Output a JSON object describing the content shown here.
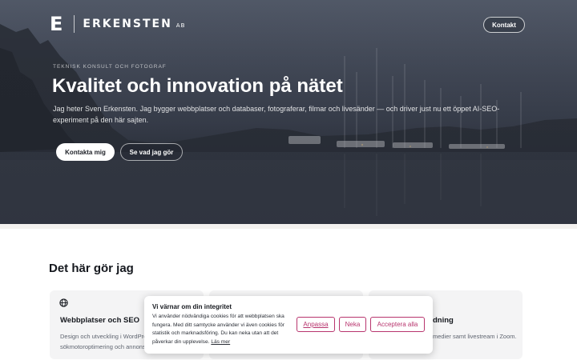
{
  "header": {
    "logo_mark": "E",
    "logo_name": "ERKENSTEN",
    "logo_suffix": "AB",
    "contact_label": "Kontakt"
  },
  "hero": {
    "eyebrow": "TEKNISK KONSULT OCH FOTOGRAF",
    "headline": "Kvalitet och innovation på nätet",
    "intro": "Jag heter Sven Erkensten. Jag bygger webbplatser och databaser, fotograferar, filmar och livesänder — och driver just nu ett öppet AI-SEO-experiment på den här sajten.",
    "primary_button": "Kontakta mig",
    "secondary_button": "Se vad jag gör"
  },
  "services": {
    "title": "Det här gör jag",
    "cards": [
      {
        "icon": "globe-icon",
        "title": "Webbplatser och SEO",
        "text": "Design och utveckling i WordPress, sökmotoroptimering och annonsering"
      },
      {
        "icon": "",
        "title": "",
        "text": ""
      },
      {
        "icon": "",
        "title": "dning",
        "text": "medier samt livestream i Zoom."
      }
    ]
  },
  "cookie": {
    "title": "Vi värnar om din integritet",
    "text": "Vi använder nödvändiga cookies för att webbplatsen ska fungera. Med ditt samtycke använder vi även cookies för statistik och marknadsföring. Du kan neka utan att det påverkar din upplevelse.",
    "link": "Läs mer",
    "customize": "Anpassa",
    "deny": "Neka",
    "accept": "Acceptera alla"
  },
  "colors": {
    "accent": "#b8356e",
    "hero_overlay": "#3e4452",
    "card_bg": "#f4f4f5"
  }
}
